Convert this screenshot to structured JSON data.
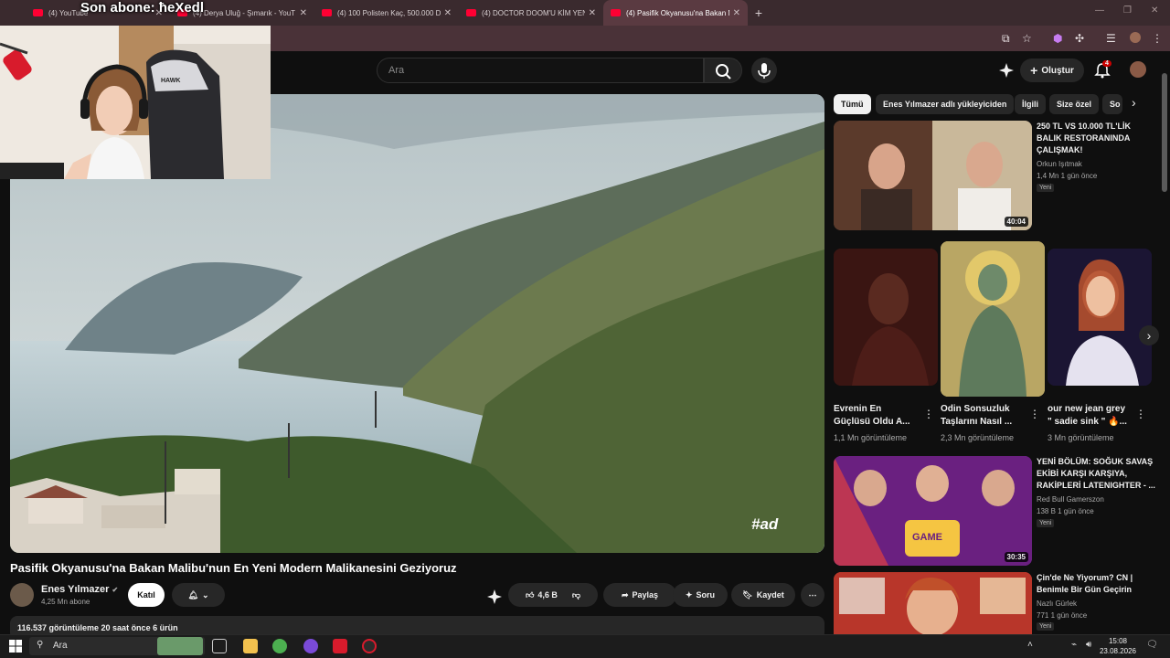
{
  "overlay": {
    "title": "Son abone: ħeXedl"
  },
  "browser": {
    "tabs": [
      {
        "label": "(4) YouTube"
      },
      {
        "label": "(4) Derya Uluğ - Şımarık - YouT"
      },
      {
        "label": "(4) 100 Polisten Kaç, 500.000 D"
      },
      {
        "label": "(4) DOCTOR DOOM'U KİM YENE"
      },
      {
        "label": "(4) Pasifik Okyanusu'na Bakan M"
      }
    ],
    "new_tab": "+",
    "close_glyph": "✕"
  },
  "youtube": {
    "search_placeholder": "Ara",
    "create_label": "Oluştur",
    "notification_count": "4",
    "video": {
      "title": "Pasifik Okyanusu'na Bakan Malibu'nun En Yeni Modern Malikanesini Geziyoruz",
      "ad_label": "#ad",
      "channel_name": "Enes Yılmazer",
      "subscribers": "4,25 Mn abone",
      "join_label": "Katıl",
      "likes": "4,6 B",
      "share_label": "Paylaş",
      "ask_label": "Soru",
      "save_label": "Kaydet",
      "description_meta": "116.537 görüntüleme  20 saat önce  6 ürün"
    },
    "chips": [
      "Tümü",
      "Enes Yılmazer adlı yükleyiciden",
      "İlgili",
      "Size özel",
      "So"
    ],
    "recommendations": [
      {
        "title_lines": [
          "250 TL VS 10.000 TL'LİK",
          "BALIK RESTORANINDA",
          "ÇALIŞMAK!"
        ],
        "channel": "Orkun Işıtmak",
        "meta": "1,4 Mn   1 gün önce",
        "badge": "Yeni",
        "duration": "40:04"
      },
      {
        "title_lines": [
          "YENİ BÖLÜM: SOĞUK SAVAŞ",
          "EKİBİ KARŞI KARŞIYA,",
          "RAKİPLERİ LATENIGHTER - ..."
        ],
        "channel": "Red Bull Gamerszon",
        "meta": "138 B   1 gün önce",
        "badge": "Yeni",
        "duration": "30:35"
      },
      {
        "title_lines": [
          "Çin'de Ne Yiyorum? CN |",
          "Benimle Bir Gün Geçirin"
        ],
        "channel": "Nazlı Gürlek",
        "meta": "771   1 gün önce",
        "badge": "Yeni"
      }
    ],
    "shorts": [
      {
        "title_lines": [
          "Evrenin En",
          "Güçlüsü Oldu A..."
        ],
        "views": "1,1 Mn görüntüleme"
      },
      {
        "title_lines": [
          "Odin Sonsuzluk",
          "Taşlarını Nasıl ..."
        ],
        "views": "2,3 Mn görüntüleme"
      },
      {
        "title_lines": [
          "our new jean grey",
          "\" sadie sink \" 🔥..."
        ],
        "views": "3 Mn görüntüleme"
      }
    ]
  },
  "taskbar": {
    "search_label": "Ara",
    "time": "15:08",
    "date": "23.08.2026"
  },
  "colors": {
    "background": "#0f0f0f",
    "accent": "#ff0033",
    "tabbar": "#3a2a2e"
  }
}
